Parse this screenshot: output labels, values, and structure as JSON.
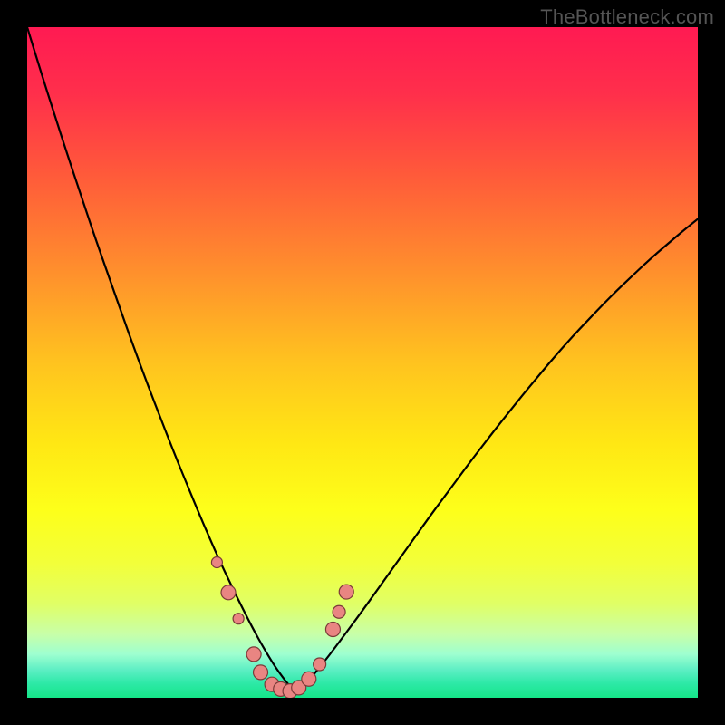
{
  "watermark": "TheBottleneck.com",
  "chart_data": {
    "type": "line",
    "title": "",
    "xlabel": "",
    "ylabel": "",
    "xlim": [
      0,
      100
    ],
    "ylim": [
      0,
      100
    ],
    "background_gradient": {
      "stops": [
        {
          "offset": 0.0,
          "color": "#ff1a52"
        },
        {
          "offset": 0.1,
          "color": "#ff2f4b"
        },
        {
          "offset": 0.22,
          "color": "#ff5a3a"
        },
        {
          "offset": 0.35,
          "color": "#ff8a2e"
        },
        {
          "offset": 0.5,
          "color": "#ffc31f"
        },
        {
          "offset": 0.62,
          "color": "#ffe714"
        },
        {
          "offset": 0.72,
          "color": "#fdff1a"
        },
        {
          "offset": 0.8,
          "color": "#f2ff3a"
        },
        {
          "offset": 0.86,
          "color": "#e0ff66"
        },
        {
          "offset": 0.905,
          "color": "#c8ffa8"
        },
        {
          "offset": 0.935,
          "color": "#9effd0"
        },
        {
          "offset": 0.958,
          "color": "#5eefc4"
        },
        {
          "offset": 0.978,
          "color": "#2ee9a8"
        },
        {
          "offset": 1.0,
          "color": "#15e588"
        }
      ]
    },
    "series": [
      {
        "name": "bottleneck-curve",
        "stroke": "#000000",
        "stroke_width": 2.2,
        "x": [
          0,
          2,
          4,
          6,
          8,
          10,
          12,
          14,
          16,
          18,
          20,
          22,
          24,
          26,
          27,
          28,
          29,
          30,
          31,
          32,
          33,
          34,
          35,
          36,
          37,
          38,
          39,
          40,
          42,
          44,
          46,
          48,
          50,
          52,
          54,
          56,
          58,
          60,
          62,
          64,
          66,
          68,
          70,
          72,
          74,
          76,
          78,
          80,
          82,
          84,
          86,
          88,
          90,
          92,
          94,
          96,
          98,
          100
        ],
        "y": [
          100,
          93.5,
          87.2,
          81.0,
          75.0,
          69.0,
          63.3,
          57.6,
          52.0,
          46.6,
          41.4,
          36.3,
          31.4,
          26.6,
          24.3,
          22.0,
          19.8,
          17.7,
          15.6,
          13.6,
          11.6,
          9.7,
          7.9,
          6.2,
          4.6,
          3.2,
          1.9,
          1.0,
          2.6,
          5.0,
          7.6,
          10.3,
          13.0,
          15.8,
          18.6,
          21.4,
          24.2,
          27.0,
          29.7,
          32.4,
          35.1,
          37.7,
          40.3,
          42.8,
          45.3,
          47.7,
          50.1,
          52.4,
          54.6,
          56.7,
          58.8,
          60.8,
          62.7,
          64.6,
          66.4,
          68.1,
          69.8,
          71.4
        ]
      }
    ],
    "markers": {
      "name": "data-points",
      "fill": "#e98582",
      "stroke": "#7a3a38",
      "stroke_width": 1.2,
      "points": [
        {
          "x": 28.3,
          "y": 20.2,
          "r": 6
        },
        {
          "x": 30.0,
          "y": 15.7,
          "r": 8
        },
        {
          "x": 31.5,
          "y": 11.8,
          "r": 6
        },
        {
          "x": 33.8,
          "y": 6.5,
          "r": 8
        },
        {
          "x": 34.8,
          "y": 3.8,
          "r": 8
        },
        {
          "x": 36.5,
          "y": 2.0,
          "r": 8
        },
        {
          "x": 37.8,
          "y": 1.3,
          "r": 8
        },
        {
          "x": 39.2,
          "y": 1.0,
          "r": 8
        },
        {
          "x": 40.5,
          "y": 1.5,
          "r": 8
        },
        {
          "x": 42.0,
          "y": 2.8,
          "r": 8
        },
        {
          "x": 43.6,
          "y": 5.0,
          "r": 7
        },
        {
          "x": 45.6,
          "y": 10.2,
          "r": 8
        },
        {
          "x": 46.5,
          "y": 12.8,
          "r": 7
        },
        {
          "x": 47.6,
          "y": 15.8,
          "r": 8
        }
      ]
    }
  }
}
